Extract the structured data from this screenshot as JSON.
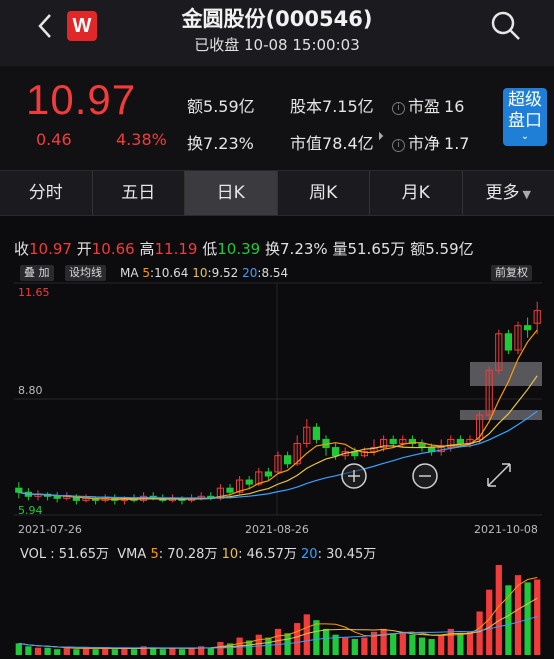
{
  "header": {
    "title": "金圆股份(000546)",
    "subtitle": "已收盘 10-08 15:00:03",
    "logo": "W"
  },
  "quote": {
    "price": "10.97",
    "change": "0.46",
    "change_pct": "4.38%",
    "amount_label": "额",
    "amount": "5.59亿",
    "turnover_label": "换",
    "turnover": "7.23%",
    "share_label": "股本",
    "share": "7.15亿",
    "mcap_label": "市值",
    "mcap": "78.4亿",
    "pe_label": "市盈",
    "pe": "16",
    "pb_label": "市净",
    "pb": "1.7",
    "super_btn": "超级\n盘口"
  },
  "tabs": [
    {
      "label": "分时"
    },
    {
      "label": "五日"
    },
    {
      "label": "日K"
    },
    {
      "label": "周K"
    },
    {
      "label": "月K"
    },
    {
      "label": "更多"
    }
  ],
  "active_tab": 2,
  "ohlc": {
    "close_l": "收",
    "close": "10.97",
    "open_l": "开",
    "open": "10.66",
    "high_l": "高",
    "high": "11.19",
    "low_l": "低",
    "low": "10.39",
    "turn_l": "换",
    "turn": "7.23%",
    "vol_l": "量",
    "vol": "51.65万",
    "amt_l": "额",
    "amt": "5.59亿"
  },
  "chips": {
    "overlay": "叠 加",
    "set_ma": "设均线",
    "adjust": "前复权"
  },
  "ma": {
    "label": "MA",
    "ma5_l": "5",
    "ma5": "10.64",
    "ma10_l": "10",
    "ma10": "9.52",
    "ma20_l": "20",
    "ma20": "8.54"
  },
  "axis": {
    "top": "11.65",
    "mid": "8.80",
    "bottom": "5.94",
    "d1": "2021-07-26",
    "d2": "2021-08-26",
    "d3": "2021-10-08"
  },
  "volume": {
    "label": "VOL",
    "value": "51.65万",
    "vma": "VMA",
    "v5_l": "5",
    "v5": "70.28万",
    "v10_l": "10",
    "v10": "46.57万",
    "v20_l": "20",
    "v20": "30.45万"
  },
  "colors": {
    "up": "#f23b3b",
    "down": "#1ec93a",
    "ma5": "#ff9900",
    "ma10": "#e8c14a",
    "ma20": "#3aa0ff",
    "accent": "#1f7fd6"
  },
  "chart_data": {
    "type": "candlestick",
    "ylim": [
      5.94,
      11.65
    ],
    "ohlc": [
      [
        6.6,
        6.5,
        6.75,
        6.35
      ],
      [
        6.5,
        6.4,
        6.6,
        6.3
      ],
      [
        6.4,
        6.45,
        6.55,
        6.3
      ],
      [
        6.45,
        6.4,
        6.5,
        6.3
      ],
      [
        6.4,
        6.35,
        6.5,
        6.25
      ],
      [
        6.35,
        6.4,
        6.5,
        6.3
      ],
      [
        6.4,
        6.3,
        6.45,
        6.2
      ],
      [
        6.3,
        6.35,
        6.45,
        6.25
      ],
      [
        6.35,
        6.3,
        6.4,
        6.2
      ],
      [
        6.3,
        6.35,
        6.45,
        6.25
      ],
      [
        6.35,
        6.3,
        6.45,
        6.2
      ],
      [
        6.3,
        6.35,
        6.4,
        6.2
      ],
      [
        6.35,
        6.3,
        6.45,
        6.25
      ],
      [
        6.3,
        6.4,
        6.5,
        6.25
      ],
      [
        6.4,
        6.35,
        6.5,
        6.3
      ],
      [
        6.35,
        6.3,
        6.45,
        6.25
      ],
      [
        6.3,
        6.35,
        6.45,
        6.25
      ],
      [
        6.35,
        6.3,
        6.4,
        6.2
      ],
      [
        6.3,
        6.35,
        6.45,
        6.25
      ],
      [
        6.35,
        6.4,
        6.5,
        6.3
      ],
      [
        6.4,
        6.35,
        6.5,
        6.3
      ],
      [
        6.35,
        6.6,
        6.7,
        6.3
      ],
      [
        6.6,
        6.5,
        6.7,
        6.4
      ],
      [
        6.5,
        6.8,
        6.9,
        6.45
      ],
      [
        6.8,
        6.7,
        6.9,
        6.6
      ],
      [
        6.7,
        7.0,
        7.1,
        6.65
      ],
      [
        7.0,
        6.9,
        7.1,
        6.8
      ],
      [
        7.0,
        7.4,
        7.5,
        6.95
      ],
      [
        7.4,
        7.2,
        7.5,
        7.1
      ],
      [
        7.2,
        7.7,
        7.9,
        7.15
      ],
      [
        7.7,
        8.1,
        8.3,
        7.6
      ],
      [
        8.1,
        7.8,
        8.2,
        7.7
      ],
      [
        7.8,
        7.6,
        7.9,
        7.4
      ],
      [
        7.6,
        7.4,
        7.7,
        7.3
      ],
      [
        7.4,
        7.5,
        7.6,
        7.3
      ],
      [
        7.5,
        7.4,
        7.6,
        7.3
      ],
      [
        7.4,
        7.5,
        7.6,
        7.35
      ],
      [
        7.5,
        7.6,
        7.8,
        7.4
      ],
      [
        7.6,
        7.8,
        7.9,
        7.5
      ],
      [
        7.8,
        7.7,
        7.9,
        7.6
      ],
      [
        7.7,
        7.8,
        7.9,
        7.6
      ],
      [
        7.8,
        7.7,
        7.9,
        7.6
      ],
      [
        7.7,
        7.6,
        7.8,
        7.5
      ],
      [
        7.6,
        7.5,
        7.7,
        7.4
      ],
      [
        7.5,
        7.6,
        7.8,
        7.4
      ],
      [
        7.6,
        7.8,
        7.9,
        7.5
      ],
      [
        7.8,
        7.7,
        7.9,
        7.6
      ],
      [
        7.7,
        7.8,
        7.9,
        7.6
      ],
      [
        7.8,
        8.4,
        8.5,
        7.7
      ],
      [
        8.4,
        9.5,
        9.6,
        8.3
      ],
      [
        9.5,
        10.4,
        10.5,
        9.4
      ],
      [
        10.4,
        10.0,
        10.5,
        9.9
      ],
      [
        10.0,
        10.6,
        10.7,
        9.9
      ],
      [
        10.6,
        10.5,
        10.8,
        10.3
      ],
      [
        10.66,
        10.97,
        11.19,
        10.39
      ]
    ],
    "volume": [
      8,
      6,
      5,
      5,
      4,
      5,
      4,
      5,
      4,
      5,
      4,
      5,
      4,
      6,
      5,
      4,
      5,
      4,
      5,
      6,
      5,
      9,
      8,
      12,
      10,
      14,
      12,
      18,
      15,
      22,
      28,
      24,
      18,
      14,
      12,
      11,
      12,
      16,
      18,
      15,
      16,
      14,
      12,
      11,
      14,
      18,
      15,
      16,
      30,
      45,
      62,
      48,
      55,
      50,
      52
    ]
  }
}
